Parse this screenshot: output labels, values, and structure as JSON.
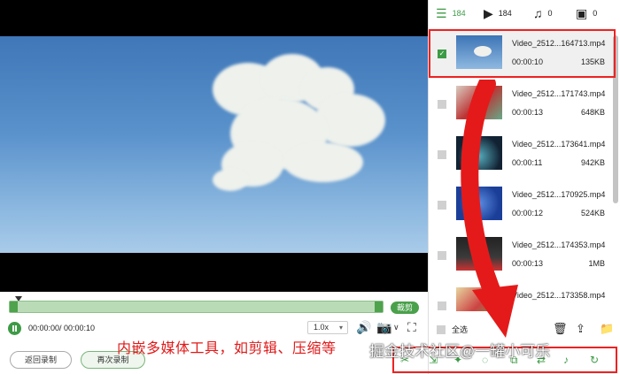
{
  "player": {
    "current_time": "00:00:00/ 00:00:10",
    "trim_label": "裁剪",
    "speed": "1.0x"
  },
  "buttons": {
    "back_label": "返回录制",
    "record_again_label": "再次录制"
  },
  "annotation": "内嵌多媒体工具，如剪辑、压缩等",
  "watermark": "掘金技术社区@一罐小可乐",
  "tabs": [
    {
      "icon": "list-icon",
      "count": "184"
    },
    {
      "icon": "video-icon",
      "count": "184"
    },
    {
      "icon": "music-icon",
      "count": "0"
    },
    {
      "icon": "image-icon",
      "count": "0"
    }
  ],
  "files": [
    {
      "name": "Video_2512...164713.mp4",
      "duration": "00:00:10",
      "size": "135KB",
      "selected": true
    },
    {
      "name": "Video_2512...171743.mp4",
      "duration": "00:00:13",
      "size": "648KB",
      "selected": false
    },
    {
      "name": "Video_2512...173641.mp4",
      "duration": "00:00:11",
      "size": "942KB",
      "selected": false
    },
    {
      "name": "Video_2512...170925.mp4",
      "duration": "00:00:12",
      "size": "524KB",
      "selected": false
    },
    {
      "name": "Video_2512...174353.mp4",
      "duration": "00:00:13",
      "size": "1MB",
      "selected": false
    },
    {
      "name": "Video_2512...173358.mp4",
      "duration": "",
      "size": "",
      "selected": false
    }
  ],
  "select_all_label": "全选",
  "colors": {
    "accent": "#3d9b45",
    "highlight": "#e22222"
  }
}
